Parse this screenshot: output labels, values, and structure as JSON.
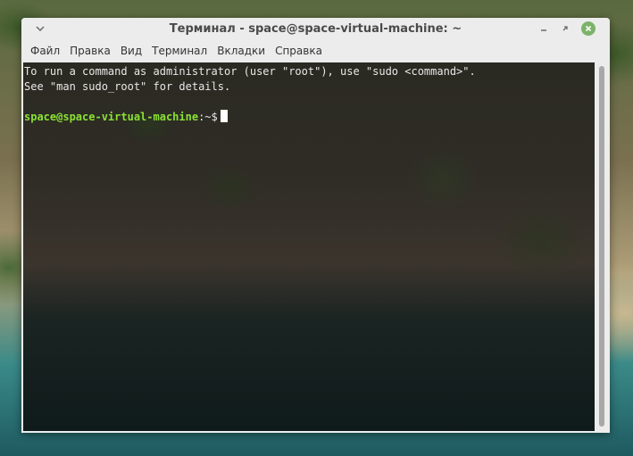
{
  "window": {
    "title": "Терминал - space@space-virtual-machine: ~"
  },
  "menu": {
    "items": [
      "Файл",
      "Правка",
      "Вид",
      "Терминал",
      "Вкладки",
      "Справка"
    ]
  },
  "terminal": {
    "lines": [
      "To run a command as administrator (user \"root\"), use \"sudo <command>\".",
      "See \"man sudo_root\" for details."
    ],
    "prompt_user": "space@space-virtual-machine",
    "prompt_suffix": ":~$"
  },
  "icons": {
    "window_menu": "chevron-down-icon",
    "minimize": "minimize-icon",
    "maximize": "maximize-icon",
    "close": "close-icon"
  },
  "colors": {
    "prompt": "#8ae234",
    "close_button": "#7cb36a"
  }
}
